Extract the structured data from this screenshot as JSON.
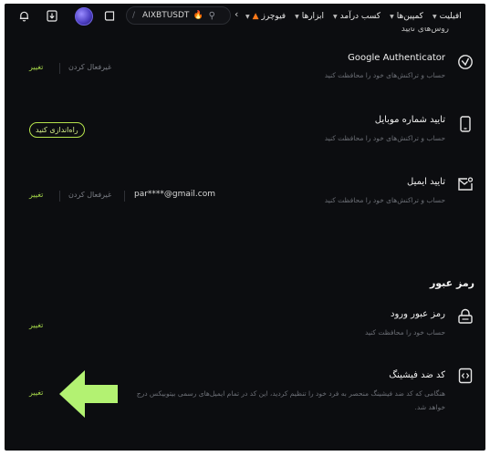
{
  "topnav": {
    "search_ticker": "AIXBTUSDT",
    "menu": [
      {
        "label": "فیوچرز",
        "has_flame": true,
        "has_caret": true
      },
      {
        "label": "ابزارها",
        "has_flame": false,
        "has_caret": true
      },
      {
        "label": "کسب درآمد",
        "has_flame": false,
        "has_caret": true
      },
      {
        "label": "کمپین‌ها",
        "has_flame": false,
        "has_caret": true
      },
      {
        "label": "افیلیت",
        "has_flame": false,
        "has_caret": true
      }
    ],
    "icons": [
      "bell-icon",
      "download-icon",
      "avatar",
      "exit-icon",
      "search-icon",
      "chevron-left-icon"
    ]
  },
  "security": {
    "partial_heading": "روش‌های تایید",
    "google": {
      "title": "Google Authenticator",
      "desc": "حساب و تراکنش‌های خود را محافظت کنید",
      "action": "تغییر",
      "disable": "غیرفعال کردن"
    },
    "mobile": {
      "title": "تایید شماره موبایل",
      "desc": "حساب و تراکنش‌های خود را محافظت کنید",
      "button": "راه‌اندازی کنید"
    },
    "email": {
      "title": "تایید ایمیل",
      "desc": "حساب و تراکنش‌های خود را محافظت کنید",
      "value": "par****@gmail.com",
      "action": "تغییر",
      "disable": "غیرفعال کردن"
    }
  },
  "password": {
    "heading": "رمز عبور",
    "login": {
      "title": "رمز عبور ورود",
      "desc": "حساب خود را محافظت کنید",
      "action": "تغییر"
    },
    "antiphishing": {
      "title": "کد ضد فیشینگ",
      "desc": "هنگامی که کد ضد فیشینگ منحصر به فرد خود را تنظیم کردید، این کد در تمام ایمیل‌های رسمی بیتوبیکس درج خواهد شد.",
      "action": "تغییر"
    }
  },
  "colors": {
    "accent": "#a7d84a",
    "background": "#0c0d10",
    "arrow": "#b3f272"
  }
}
